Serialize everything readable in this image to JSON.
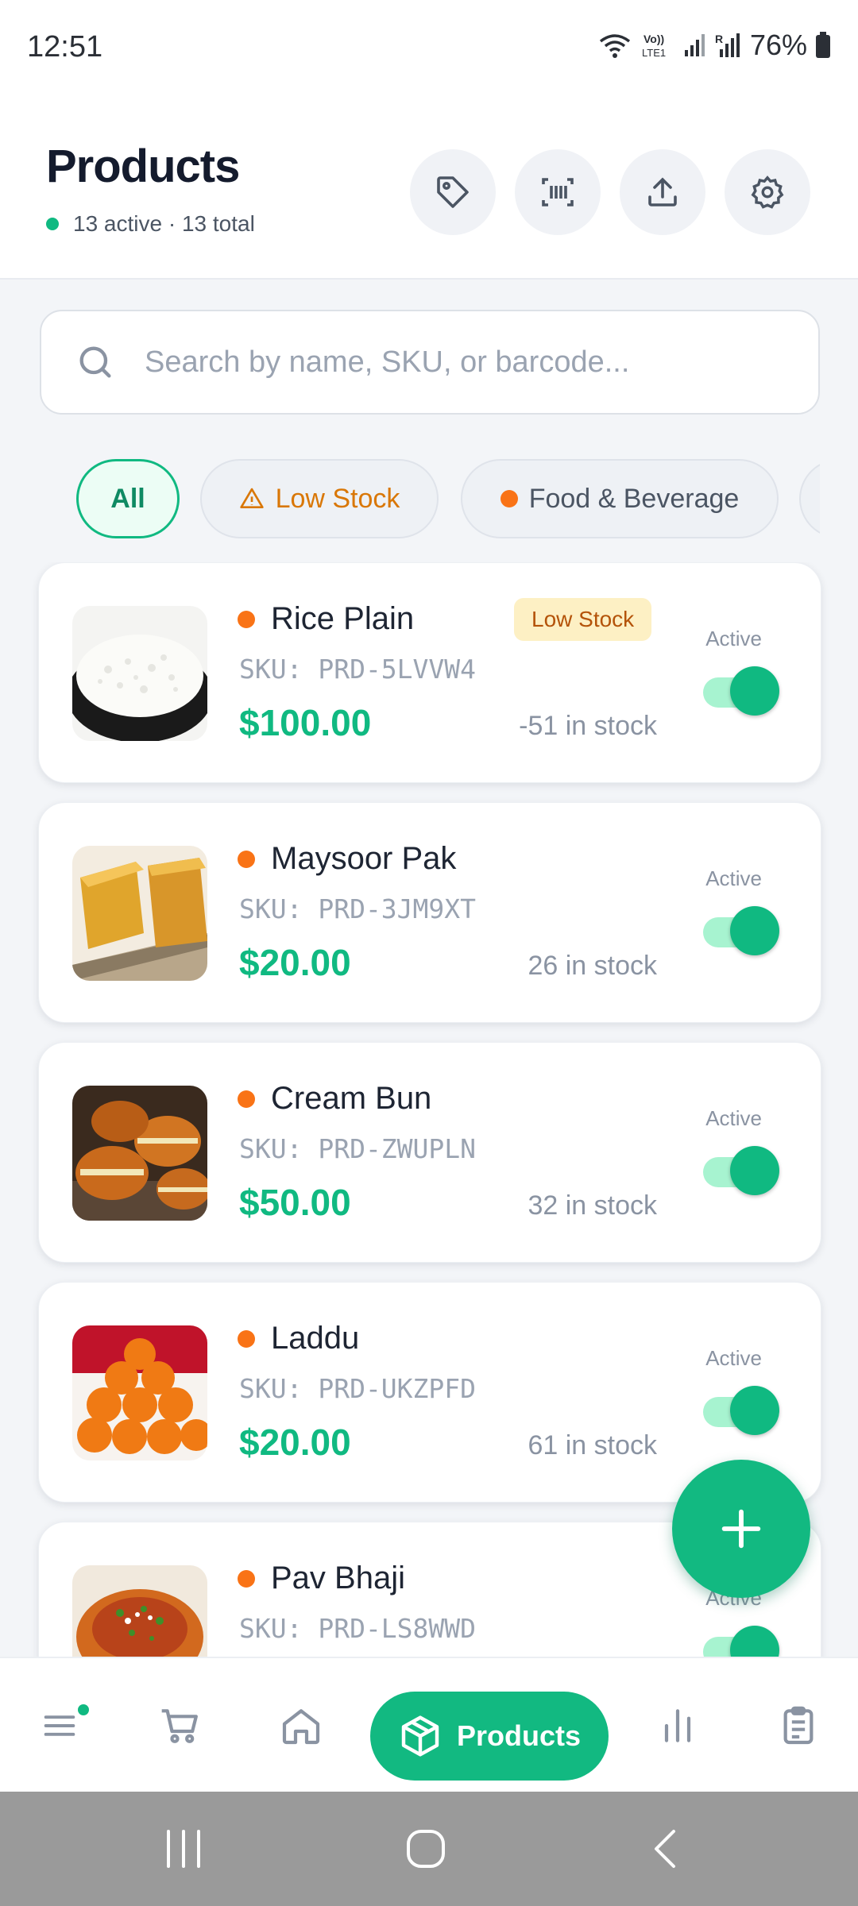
{
  "status_bar": {
    "time": "12:51",
    "battery": "76%",
    "icons": [
      "wifi-icon",
      "volte-icon",
      "signal-icon",
      "signal-r-icon",
      "battery-icon"
    ]
  },
  "header": {
    "title": "Products",
    "summary": "13 active · 13 total",
    "actions": [
      "tag-icon",
      "barcode-scan-icon",
      "upload-icon",
      "settings-icon"
    ]
  },
  "search": {
    "placeholder": "Search by name, SKU, or barcode..."
  },
  "filters": [
    {
      "label": "All",
      "selected": true
    },
    {
      "label": "Low Stock",
      "icon": "warning-icon"
    },
    {
      "label": "Food & Beverage"
    }
  ],
  "products": [
    {
      "name": "Rice Plain",
      "sku": "SKU: PRD-5LVVW4",
      "price": "$100.00",
      "stock": "-51 in stock",
      "badge": "Low Stock",
      "status": "Active",
      "active": true
    },
    {
      "name": "Maysoor Pak",
      "sku": "SKU: PRD-3JM9XT",
      "price": "$20.00",
      "stock": "26 in stock",
      "status": "Active",
      "active": true
    },
    {
      "name": "Cream Bun",
      "sku": "SKU: PRD-ZWUPLN",
      "price": "$50.00",
      "stock": "32 in stock",
      "status": "Active",
      "active": true
    },
    {
      "name": "Laddu",
      "sku": "SKU: PRD-UKZPFD",
      "price": "$20.00",
      "stock": "61 in stock",
      "status": "Active",
      "active": true
    },
    {
      "name": "Pav Bhaji",
      "sku": "SKU: PRD-LS8WWD",
      "status": "Active",
      "active": true
    }
  ],
  "bottom_nav": {
    "active_label": "Products",
    "items": [
      "menu-icon",
      "cart-icon",
      "home-icon",
      "products-icon",
      "analytics-icon",
      "clipboard-icon"
    ]
  },
  "colors": {
    "accent": "#10b981",
    "warning": "#d97706",
    "category_dot": "#f97316"
  }
}
